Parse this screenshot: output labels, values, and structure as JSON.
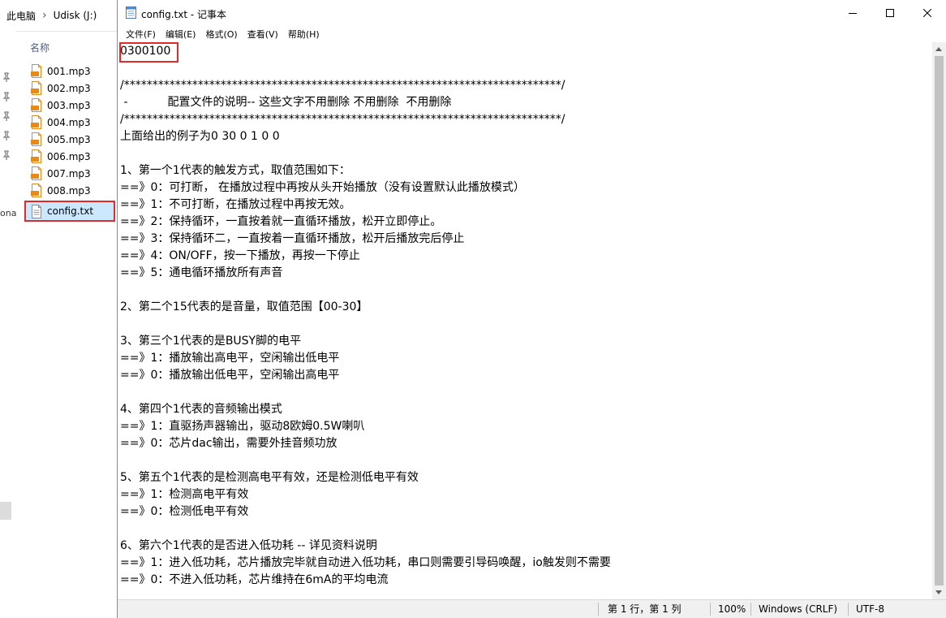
{
  "explorer": {
    "breadcrumb": [
      "此电脑",
      "Udisk (J:)"
    ],
    "nav_fragment": "ona",
    "column_header": "名称",
    "files": [
      {
        "name": "001.mp3",
        "type": "mp3",
        "icon": "mp3-file-icon"
      },
      {
        "name": "002.mp3",
        "type": "mp3",
        "icon": "mp3-file-icon"
      },
      {
        "name": "003.mp3",
        "type": "mp3",
        "icon": "mp3-file-icon"
      },
      {
        "name": "004.mp3",
        "type": "mp3",
        "icon": "mp3-file-icon"
      },
      {
        "name": "005.mp3",
        "type": "mp3",
        "icon": "mp3-file-icon"
      },
      {
        "name": "006.mp3",
        "type": "mp3",
        "icon": "mp3-file-icon"
      },
      {
        "name": "007.mp3",
        "type": "mp3",
        "icon": "mp3-file-icon"
      },
      {
        "name": "008.mp3",
        "type": "mp3",
        "icon": "mp3-file-icon"
      },
      {
        "name": "config.txt",
        "type": "txt",
        "icon": "text-file-icon",
        "selected": true
      }
    ]
  },
  "notepad": {
    "title": "config.txt - 记事本",
    "menu": [
      "文件(F)",
      "编辑(E)",
      "格式(O)",
      "查看(V)",
      "帮助(H)"
    ],
    "lines": [
      "0300100",
      "",
      "/*****************************************************************************/",
      " -           配置文件的说明-- 这些文字不用删除 不用删除  不用删除",
      "/*****************************************************************************/",
      "上面给出的例子为0 30 0 1 0 0",
      "",
      "1、第一个1代表的触发方式，取值范围如下：",
      "==》0：可打断， 在播放过程中再按从头开始播放（没有设置默认此播放模式）",
      "==》1：不可打断，在播放过程中再按无效。",
      "==》2：保持循环，一直按着就一直循环播放，松开立即停止。",
      "==》3：保持循环二，一直按着一直循环播放，松开后播放完后停止",
      "==》4：ON/OFF，按一下播放，再按一下停止",
      "==》5：通电循环播放所有声音",
      "",
      "2、第二个15代表的是音量，取值范围【00-30】",
      "",
      "3、第三个1代表的是BUSY脚的电平",
      "==》1：播放输出高电平，空闲输出低电平",
      "==》0：播放输出低电平，空闲输出高电平",
      "",
      "4、第四个1代表的音频输出模式",
      "==》1：直驱扬声器输出，驱动8欧姆0.5W喇叭",
      "==》0：芯片dac输出，需要外挂音频功放",
      "",
      "5、第五个1代表的是检测高电平有效，还是检测低电平有效",
      "==》1：检测高电平有效",
      "==》0：检测低电平有效",
      "",
      "6、第六个1代表的是否进入低功耗 -- 详见资料说明",
      "==》1：进入低功耗，芯片播放完毕就自动进入低功耗，串口则需要引导码唤醒，io触发则不需要",
      "==》0：不进入低功耗，芯片维持在6mA的平均电流"
    ],
    "status": {
      "position": "第 1 行，第 1 列",
      "zoom": "100%",
      "line_ending": "Windows (CRLF)",
      "encoding": "UTF-8"
    }
  },
  "colors": {
    "highlight_border": "#e02b2b",
    "selection_bg": "#cce8ff",
    "mp3_icon": "#e88a1a",
    "status_bg": "#f0f0f0"
  }
}
